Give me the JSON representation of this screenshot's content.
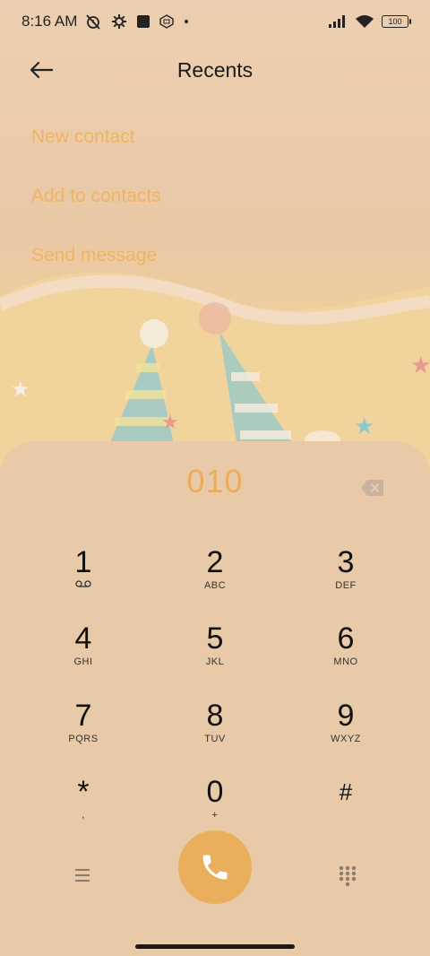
{
  "status_bar": {
    "time": "8:16 AM",
    "battery": "100",
    "icons_left": [
      "alarm-off-icon",
      "settings-icon",
      "square-icon",
      "sim-icon",
      "dot-icon"
    ],
    "icons_right": [
      "signal-icon",
      "wifi-icon",
      "battery-icon"
    ]
  },
  "header": {
    "title": "Recents",
    "back_icon": "arrow-left-icon"
  },
  "actions": [
    {
      "label": "New contact"
    },
    {
      "label": "Add to contacts"
    },
    {
      "label": "Send message"
    }
  ],
  "dialer": {
    "entered_number": "010",
    "backspace_icon": "backspace-icon",
    "keys": [
      {
        "digit": "1",
        "letters": ""
      },
      {
        "digit": "2",
        "letters": "ABC"
      },
      {
        "digit": "3",
        "letters": "DEF"
      },
      {
        "digit": "4",
        "letters": "GHI"
      },
      {
        "digit": "5",
        "letters": "JKL"
      },
      {
        "digit": "6",
        "letters": "MNO"
      },
      {
        "digit": "7",
        "letters": "PQRS"
      },
      {
        "digit": "8",
        "letters": "TUV"
      },
      {
        "digit": "9",
        "letters": "WXYZ"
      },
      {
        "digit": "*",
        "letters": ","
      },
      {
        "digit": "0",
        "letters": "+"
      },
      {
        "digit": "#",
        "letters": ""
      }
    ]
  },
  "bottom_bar": {
    "menu_icon": "menu-icon",
    "call_icon": "phone-icon",
    "keypad_icon": "dialpad-icon"
  },
  "colors": {
    "accent": "#eaaf5c",
    "action_text": "#efb461",
    "background": "#e8c9a8"
  }
}
